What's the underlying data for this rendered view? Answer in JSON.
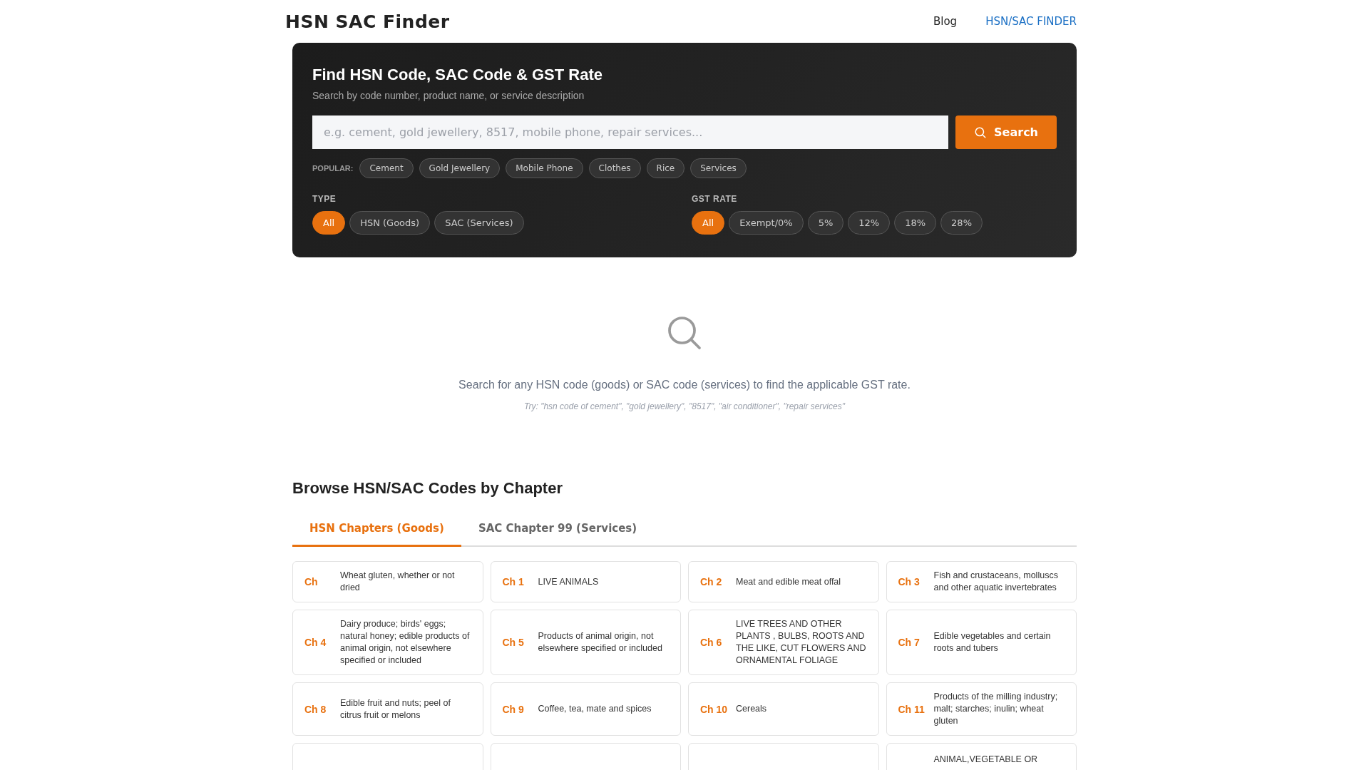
{
  "header": {
    "brand": "HSN SAC Finder",
    "nav": [
      {
        "label": "Blog",
        "selected": false
      },
      {
        "label": "HSN/SAC FINDER",
        "selected": true
      }
    ]
  },
  "search_panel": {
    "title": "Find HSN Code, SAC Code & GST Rate",
    "subtitle": "Search by code number, product name, or service description",
    "placeholder": "e.g. cement, gold jewellery, 8517, mobile phone, repair services...",
    "button": "Search",
    "popular_label": "POPULAR:",
    "popular": [
      "Cement",
      "Gold Jewellery",
      "Mobile Phone",
      "Clothes",
      "Rice",
      "Services"
    ],
    "filters": [
      {
        "label": "TYPE",
        "options": [
          {
            "label": "All",
            "selected": true
          },
          {
            "label": "HSN (Goods)",
            "selected": false
          },
          {
            "label": "SAC (Services)",
            "selected": false
          }
        ]
      },
      {
        "label": "GST RATE",
        "options": [
          {
            "label": "All",
            "selected": true
          },
          {
            "label": "Exempt/0%",
            "selected": false
          },
          {
            "label": "5%",
            "selected": false
          },
          {
            "label": "12%",
            "selected": false
          },
          {
            "label": "18%",
            "selected": false
          },
          {
            "label": "28%",
            "selected": false
          }
        ]
      }
    ]
  },
  "empty_state": {
    "message": "Search for any HSN code (goods) or SAC code (services) to find the applicable GST rate.",
    "hint": "Try: \"hsn code of cement\", \"gold jewellery\", \"8517\", \"air conditioner\", \"repair services\""
  },
  "browse": {
    "title": "Browse HSN/SAC Codes by Chapter",
    "tabs": [
      {
        "label": "HSN Chapters (Goods)",
        "selected": true
      },
      {
        "label": "SAC Chapter 99 (Services)",
        "selected": false
      }
    ],
    "chapters": [
      {
        "kind": "chapter",
        "chapter": "Ch",
        "description": "Wheat gluten, whether or not dried"
      },
      {
        "kind": "chapter",
        "chapter": "Ch 1",
        "description": "LIVE ANIMALS"
      },
      {
        "kind": "chapter",
        "chapter": "Ch 2",
        "description": "Meat and edible meat offal"
      },
      {
        "kind": "chapter",
        "chapter": "Ch 3",
        "description": "Fish and crustaceans, molluscs and other aquatic invertebrates"
      },
      {
        "kind": "chapter",
        "chapter": "Ch 4",
        "description": "Dairy produce; birds' eggs; natural honey; edible products of animal origin, not elsewhere specified or included"
      },
      {
        "kind": "chapter",
        "chapter": "Ch 5",
        "description": "Products of animal origin, not elsewhere specified or included"
      },
      {
        "kind": "chapter",
        "chapter": "Ch 6",
        "description": "LIVE TREES AND OTHER PLANTS , BULBS, ROOTS AND THE LIKE, CUT FLOWERS AND ORNAMENTAL FOLIAGE"
      },
      {
        "kind": "chapter",
        "chapter": "Ch 7",
        "description": "Edible vegetables and certain roots and tubers"
      },
      {
        "kind": "chapter",
        "chapter": "Ch 8",
        "description": "Edible fruit and nuts; peel of citrus fruit or melons"
      },
      {
        "kind": "chapter",
        "chapter": "Ch 9",
        "description": "Coffee, tea, mate and spices"
      },
      {
        "kind": "chapter",
        "chapter": "Ch 10",
        "description": "Cereals"
      },
      {
        "kind": "chapter",
        "chapter": "Ch 11",
        "description": "Products of the milling industry; malt; starches; inulin; wheat gluten"
      },
      {
        "kind": "cut-off"
      },
      {
        "kind": "cut-off"
      },
      {
        "kind": "cut-off"
      },
      {
        "kind": "cut-off",
        "description": "ANIMAL,VEGETABLE OR"
      }
    ]
  }
}
